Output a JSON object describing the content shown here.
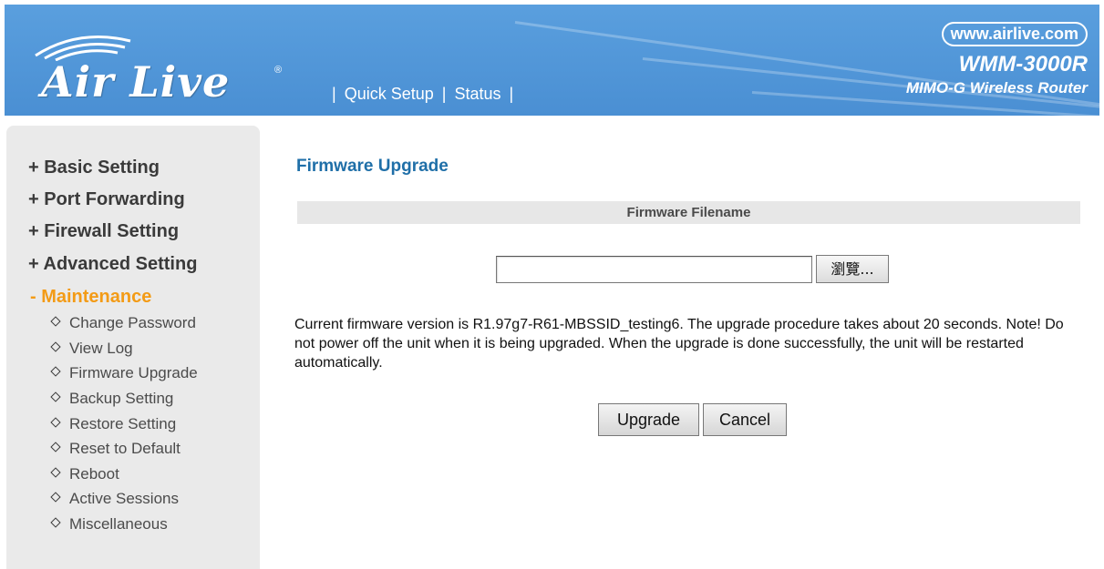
{
  "header": {
    "logo_text": "Air Live",
    "logo_reg": "®",
    "nav": [
      {
        "label": "Quick Setup"
      },
      {
        "label": "Status"
      }
    ],
    "url": "www.airlive.com",
    "model": "WMM-3000R",
    "subtitle": "MIMO-G Wireless Router"
  },
  "sidebar": {
    "main_items": [
      {
        "label": "+ Basic Setting"
      },
      {
        "label": "+ Port Forwarding"
      },
      {
        "label": "+ Firewall Setting"
      },
      {
        "label": "+ Advanced Setting"
      },
      {
        "label": "- Maintenance"
      }
    ],
    "sub_items": [
      {
        "label": "Change Password"
      },
      {
        "label": "View Log"
      },
      {
        "label": "Firmware Upgrade"
      },
      {
        "label": "Backup Setting"
      },
      {
        "label": "Restore Setting"
      },
      {
        "label": "Reset to Default"
      },
      {
        "label": "Reboot"
      },
      {
        "label": "Active Sessions"
      },
      {
        "label": "Miscellaneous"
      }
    ]
  },
  "main": {
    "title": "Firmware Upgrade",
    "section_header": "Firmware Filename",
    "file_input_value": "",
    "browse_label": "瀏覽...",
    "info": "Current firmware version is R1.97g7-R61-MBSSID_testing6. The upgrade procedure takes about 20 seconds. Note! Do not power off the unit when it is being upgraded. When the upgrade is done successfully, the unit will be restarted automatically.",
    "upgrade_label": "Upgrade",
    "cancel_label": "Cancel"
  },
  "colors": {
    "header_blue": "#4a8fd3",
    "title_blue": "#1f6fa8",
    "active_orange": "#f39b16",
    "sidebar_bg": "#eaeaea"
  }
}
